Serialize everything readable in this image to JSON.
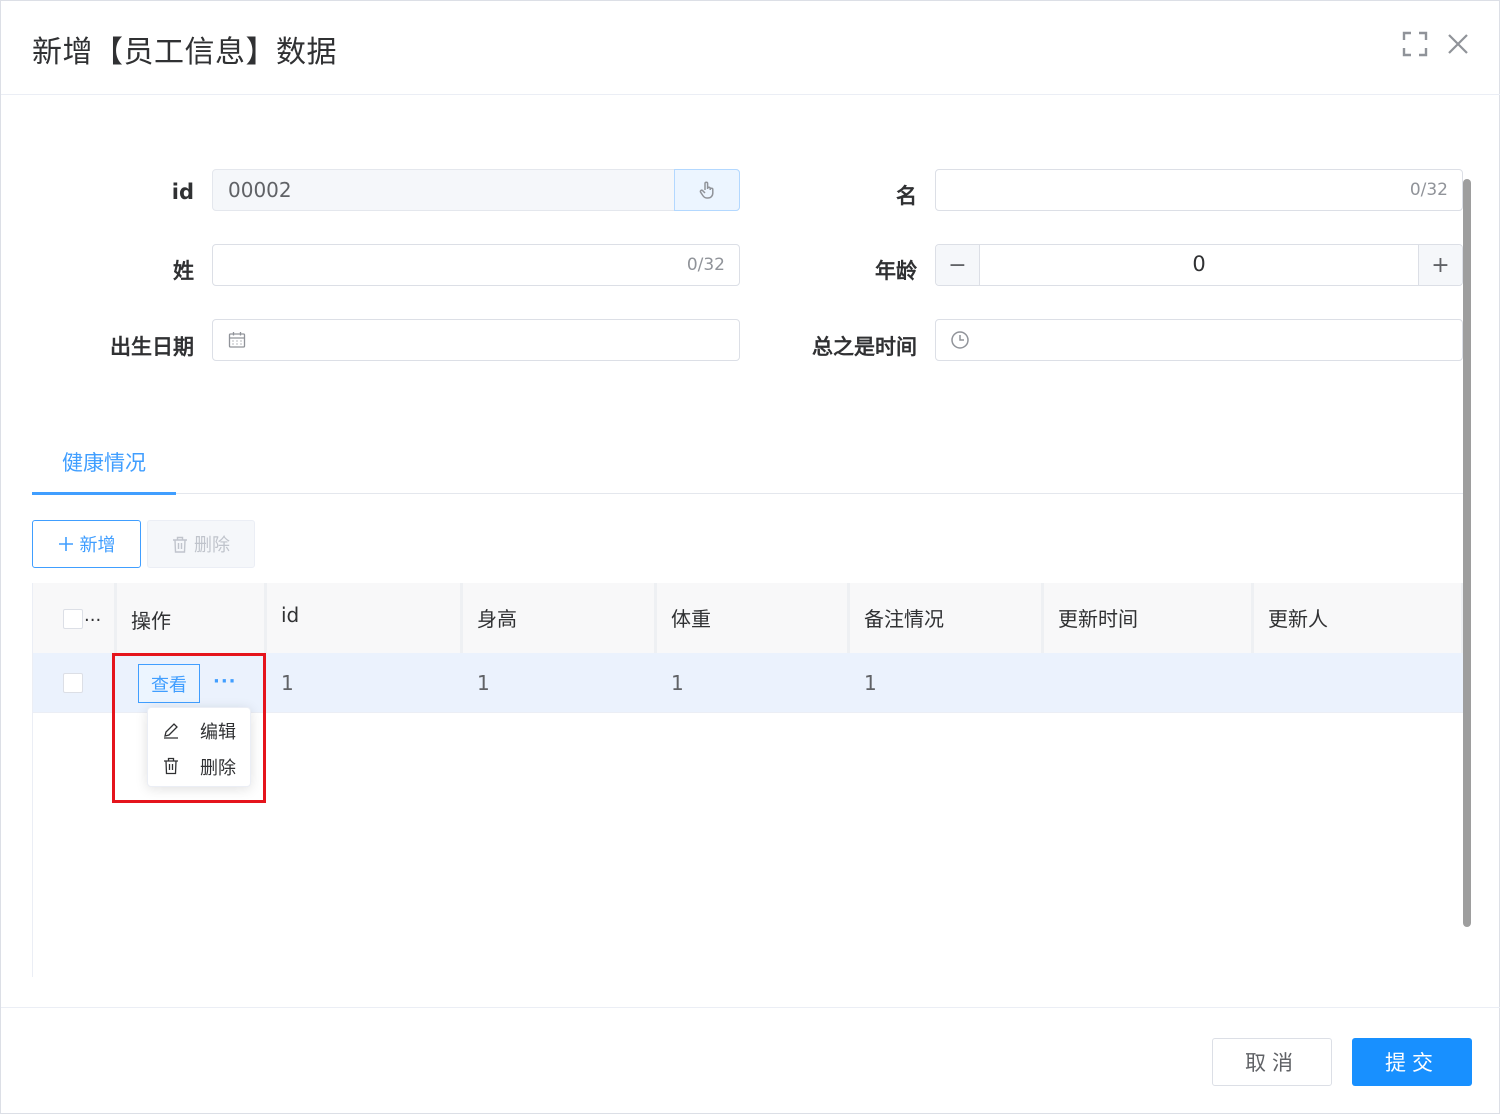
{
  "dialog": {
    "title": "新增【员工信息】数据"
  },
  "form": {
    "id": {
      "label": "id",
      "value": "00002"
    },
    "first_name": {
      "label": "名",
      "count": "0/32"
    },
    "last_name": {
      "label": "姓",
      "count": "0/32"
    },
    "age": {
      "label": "年龄",
      "value": "0",
      "minus": "−",
      "plus": "+"
    },
    "birth_date": {
      "label": "出生日期"
    },
    "summary_time": {
      "label": "总之是时间"
    }
  },
  "tabs": [
    {
      "label": "健康情况",
      "active": true
    }
  ],
  "toolbar": {
    "add_label": "新增",
    "delete_label": "删除"
  },
  "table": {
    "select_all_ellipsis": "...",
    "columns": [
      "操作",
      "id",
      "身高",
      "体重",
      "备注情况",
      "更新时间",
      "更新人"
    ],
    "rows": [
      {
        "id": "1",
        "height": "1",
        "weight": "1",
        "remark": "1",
        "updated_at": "",
        "updated_by": ""
      }
    ],
    "view_label": "查看",
    "more_label": "···"
  },
  "dropdown": {
    "items": [
      {
        "label": "编辑",
        "icon": "edit-icon"
      },
      {
        "label": "删除",
        "icon": "trash-icon"
      }
    ]
  },
  "footer": {
    "cancel_label": "取消",
    "submit_label": "提交"
  },
  "colors": {
    "primary": "#409eff",
    "submit": "#1890ff",
    "highlight": "#e5141c"
  }
}
